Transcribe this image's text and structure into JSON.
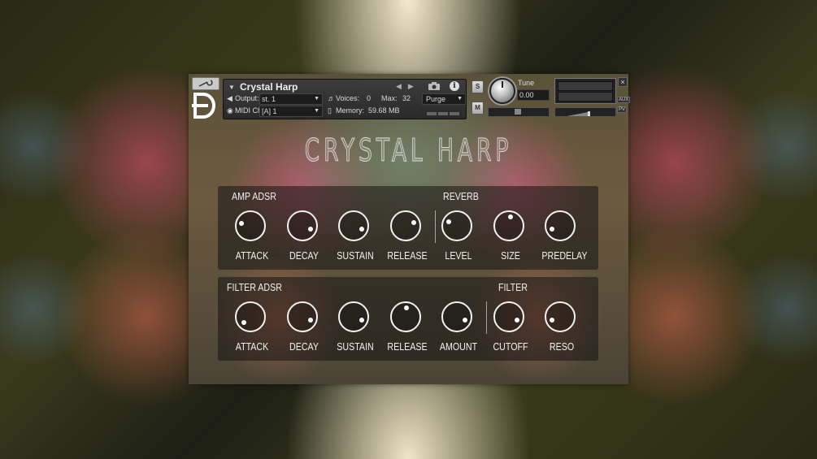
{
  "header": {
    "instrument_name": "Crystal Harp",
    "output_label": "Output:",
    "output_value": "st. 1",
    "midi_label": "MIDI Ch:",
    "midi_value": "[A]  1",
    "voices_label": "Voices:",
    "voices_value": "0",
    "max_label": "Max:",
    "max_value": "32",
    "memory_label": "Memory:",
    "memory_value": "59.68 MB",
    "purge_label": "Purge",
    "solo_label": "S",
    "mute_label": "M",
    "tune_label": "Tune",
    "tune_value": "0.00",
    "close_label": "×",
    "aux_label": "AUX",
    "pv_label": "PV"
  },
  "title": "CRYSTAL HARP",
  "amp_section": {
    "label_left": "AMP ADSR",
    "label_right": "REVERB",
    "knobs": [
      {
        "label": "ATTACK",
        "value": 0.25
      },
      {
        "label": "DECAY",
        "value": 0.88
      },
      {
        "label": "SUSTAIN",
        "value": 0.88
      },
      {
        "label": "RELEASE",
        "value": 0.72
      },
      {
        "label": "LEVEL",
        "value": 0.3
      },
      {
        "label": "SIZE",
        "value": 0.55
      },
      {
        "label": "PREDELAY",
        "value": 0.12
      }
    ]
  },
  "filter_section": {
    "label_left": "FILTER ADSR",
    "label_right": "FILTER",
    "knobs": [
      {
        "label": "ATTACK",
        "value": 0.06
      },
      {
        "label": "DECAY",
        "value": 0.88
      },
      {
        "label": "SUSTAIN",
        "value": 0.88
      },
      {
        "label": "RELEASE",
        "value": 0.52
      },
      {
        "label": "AMOUNT",
        "value": 0.88
      },
      {
        "label": "CUTOFF",
        "value": 0.88
      },
      {
        "label": "RESO",
        "value": 0.12
      }
    ]
  }
}
